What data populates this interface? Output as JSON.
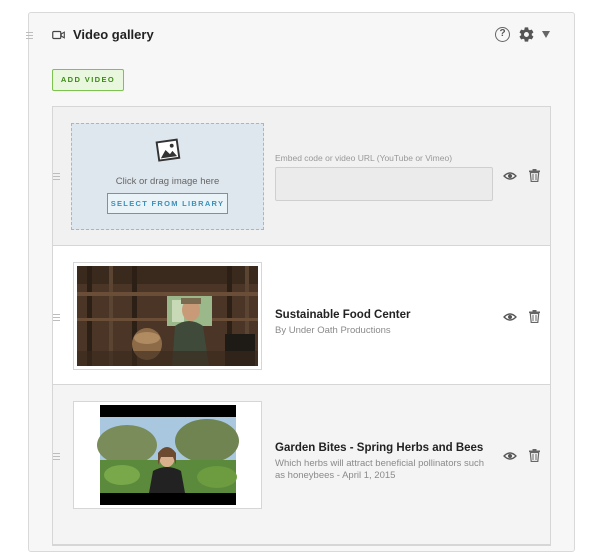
{
  "panel": {
    "title": "Video gallery",
    "help_label": "?"
  },
  "toolbar": {
    "add_video_label": "ADD VIDEO"
  },
  "upload": {
    "prompt": "Click or drag image here",
    "library_button": "SELECT FROM LIBRARY",
    "embed_label": "Embed code or video URL (YouTube or Vimeo)",
    "embed_value": "",
    "embed_placeholder": ""
  },
  "videos": [
    {
      "title": "Sustainable Food Center",
      "subtitle": "By Under Oath Productions"
    },
    {
      "title": "Garden Bites - Spring Herbs and Bees",
      "subtitle": "Which herbs will attract beneficial pollinators such as honeybees - April 1, 2015"
    }
  ],
  "icons": {
    "video": "video-camera-icon",
    "help": "question-circle-icon",
    "settings": "gear-icon",
    "menu": "caret-down-icon",
    "image": "image-icon",
    "preview": "eye-icon",
    "delete": "trash-icon",
    "drag": "drag-handle-icon"
  },
  "colors": {
    "accent_green": "#7cc34f",
    "accent_blue": "#4aa3c8",
    "dropzone_bg": "#dfe7ee"
  }
}
